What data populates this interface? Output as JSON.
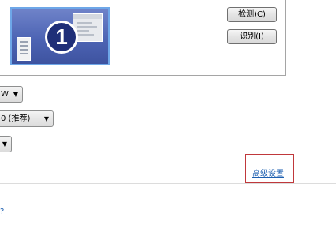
{
  "preview": {
    "monitor_number": "1",
    "buttons": {
      "detect_label": "检测(C)",
      "identify_label": "识别(I)"
    }
  },
  "settings": {
    "dropdown_1_value": "W",
    "dropdown_2_value": "0 (推荐)",
    "dropdown_3_value": ""
  },
  "links": {
    "advanced_settings": "高级设置",
    "help_fragment": "?"
  },
  "colors": {
    "highlight_border": "#c0383b",
    "link": "#1d5fb0",
    "monitor_blue": "#4d64b4"
  }
}
